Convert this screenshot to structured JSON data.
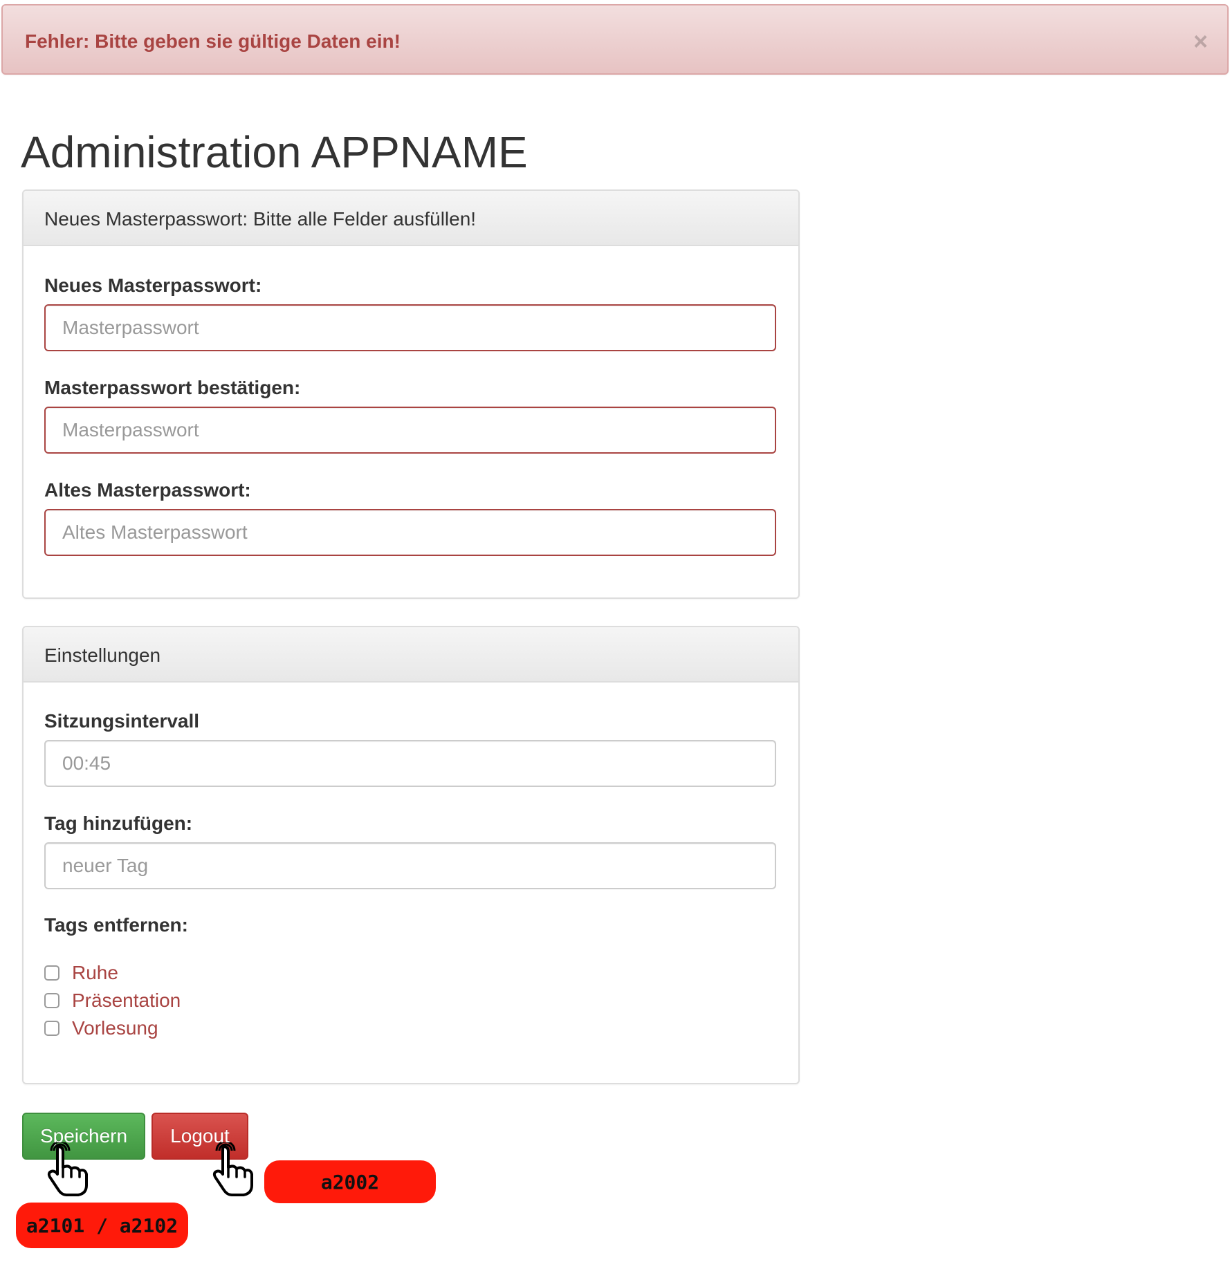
{
  "alert": {
    "text": "Fehler: Bitte geben sie gültige Daten ein!",
    "close": "×"
  },
  "page_title": "Administration APPNAME",
  "password_panel": {
    "heading": "Neues Masterpasswort: Bitte alle Felder ausfüllen!",
    "new_label": "Neues Masterpasswort:",
    "new_placeholder": "Masterpasswort",
    "confirm_label": "Masterpasswort bestätigen:",
    "confirm_placeholder": "Masterpasswort",
    "old_label": "Altes Masterpasswort:",
    "old_placeholder": "Altes Masterpasswort"
  },
  "settings_panel": {
    "heading": "Einstellungen",
    "session_label": "Sitzungsintervall",
    "session_value": "00:45",
    "tag_add_label": "Tag hinzufügen:",
    "tag_add_placeholder": "neuer Tag",
    "tags_remove_label": "Tags entfernen:",
    "tags": [
      {
        "label": "Ruhe",
        "checked": false
      },
      {
        "label": "Präsentation",
        "checked": false
      },
      {
        "label": "Vorlesung",
        "checked": false
      }
    ]
  },
  "buttons": {
    "save": "Speichern",
    "logout": "Logout"
  },
  "annotations": {
    "logout_tag": "a2002",
    "save_tag": "a2101 / a2102"
  },
  "colors": {
    "error": "#a94442",
    "success": "#5cb85c",
    "danger": "#d9534f",
    "annotation": "#ff1a0a"
  }
}
